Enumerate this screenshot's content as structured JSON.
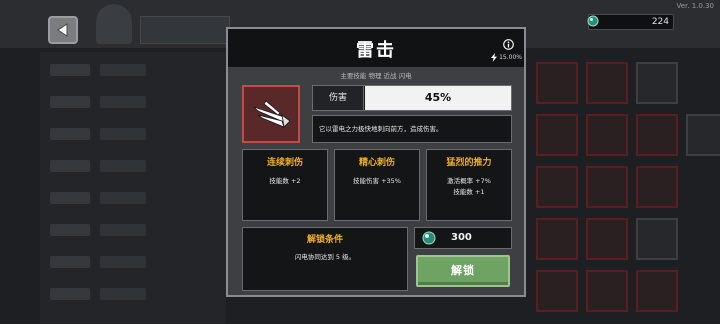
{
  "version": "Ver. 1.0.30",
  "currency": {
    "value": "224",
    "icon": "gem-icon"
  },
  "modal": {
    "title": "雷击",
    "crit_chance": "15.00%",
    "tags": "主要技能  物理  近战  闪电",
    "damage_label": "伤害",
    "damage_value": "45%",
    "description": "它以雷电之力极快地刺向前方，造成伤害。",
    "upgrades": [
      {
        "title": "连续刺伤",
        "lines": [
          "技能数 +2",
          ""
        ]
      },
      {
        "title": "精心刺伤",
        "lines": [
          "技能伤害 +35%",
          ""
        ]
      },
      {
        "title": "猛烈的推力",
        "lines": [
          "激活概率 +7%",
          "技能数 +1"
        ]
      }
    ],
    "unlock_title": "解锁条件",
    "unlock_condition": "闪电协同达到 5 级。",
    "cost": "300",
    "unlock_button": "解锁"
  },
  "colors": {
    "accent_gold": "#f0b02a",
    "button_green": "#6ea363",
    "skill_red": "#c24a48"
  }
}
